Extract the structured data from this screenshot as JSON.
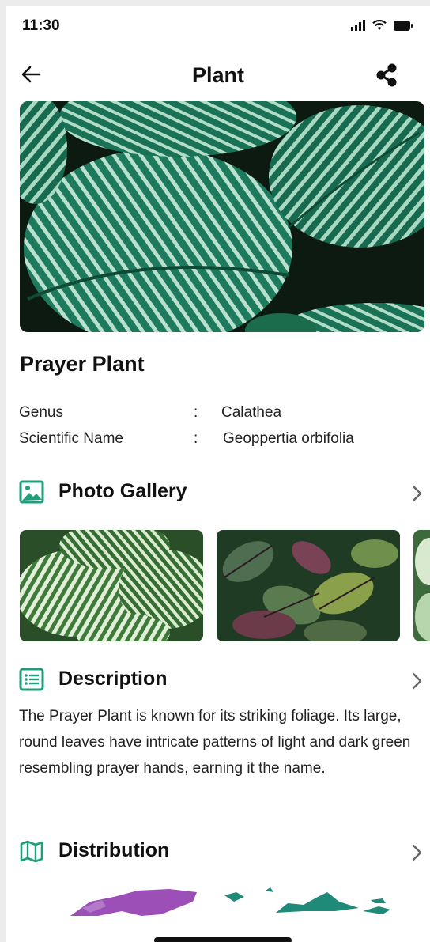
{
  "status_bar": {
    "time": "11:30"
  },
  "app_bar": {
    "title": "Plant"
  },
  "plant": {
    "name": "Prayer Plant",
    "details": [
      {
        "label": "Genus",
        "sep": ":",
        "value": "Calathea"
      },
      {
        "label": "Scientific Name",
        "sep": ":",
        "value": "Geoppertia orbifolia"
      }
    ]
  },
  "sections": {
    "gallery": {
      "title": "Photo Gallery",
      "icon": "image-icon"
    },
    "description": {
      "title": "Description",
      "icon": "list-icon",
      "text": "The Prayer Plant is known for its striking foliage. Its large, round leaves have intricate patterns of light and dark green resembling prayer hands, earning it the name."
    },
    "distribution": {
      "title": "Distribution",
      "icon": "map-icon"
    }
  },
  "colors": {
    "accent": "#1e9e7a",
    "map_purple": "#9b4fb7",
    "map_teal": "#1f8a78"
  }
}
